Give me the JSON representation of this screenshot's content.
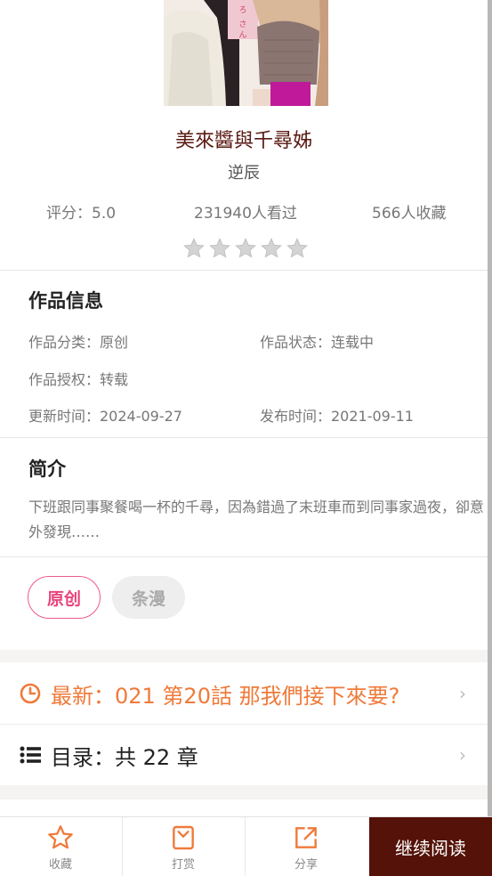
{
  "comic": {
    "title": "美來醬與千尋姊",
    "author": "逆辰",
    "rating_text": "评分：5.0",
    "views_text": "231940人看过",
    "favorites_text": "566人收藏"
  },
  "info": {
    "section_title": "作品信息",
    "category": "作品分类：原创",
    "status": "作品状态：连载中",
    "license": "作品授权：转载",
    "updated": "更新时间：2024-09-27",
    "published": "发布时间：2021-09-11"
  },
  "intro": {
    "section_title": "简介",
    "text": "下班跟同事聚餐喝一杯的千尋，因為錯過了末班車而到同事家過夜，卻意外發現……"
  },
  "tags": [
    "原创",
    "条漫"
  ],
  "latest": {
    "label": "最新：021 第20話 那我們接下來要?",
    "color": "#ef7a3a",
    "icon": "clock-icon"
  },
  "catalog": {
    "label": "目录：共 22 章",
    "icon": "list-icon"
  },
  "bottom_bar": {
    "favorite": "收藏",
    "reward": "打赏",
    "share": "分享",
    "continue": "继续阅读"
  },
  "colors": {
    "accent": "#ef7a3a",
    "title": "#5a1a12",
    "read_button": "#541208",
    "tag_pink": "#e8457c"
  }
}
